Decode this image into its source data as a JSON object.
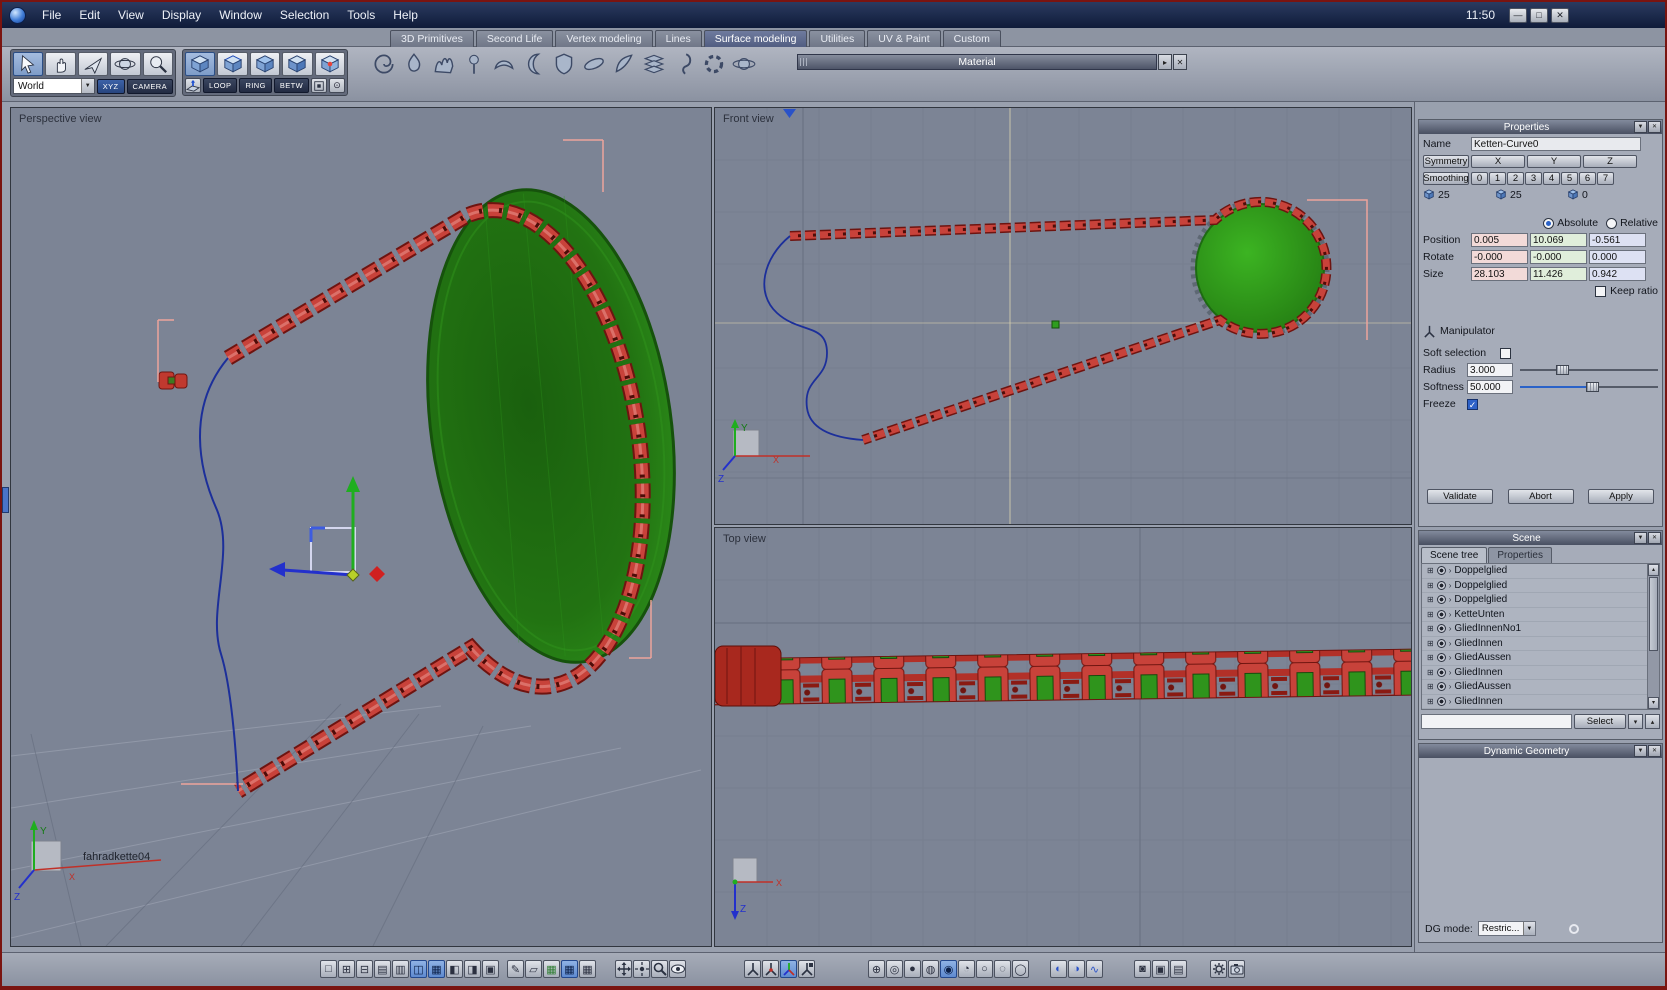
{
  "colors": {
    "accent_blue": "#3a72c8",
    "chain_red": "#c8423a",
    "sprocket_green": "#2f941c",
    "selection_blue": "#5e8ad0"
  },
  "menubar": {
    "clock": "11:50",
    "items": [
      "File",
      "Edit",
      "View",
      "Display",
      "Window",
      "Selection",
      "Tools",
      "Help"
    ]
  },
  "tabs": [
    "3D Primitives",
    "Second Life",
    "Vertex modeling",
    "Lines",
    "Surface modeling",
    "Utilities",
    "UV & Paint",
    "Custom"
  ],
  "toolbar": {
    "world": "World",
    "xyz": "XYZ",
    "camera": "CAMERA",
    "loop": "LOOP",
    "ring": "RING",
    "betw": "BETW",
    "material": "Material"
  },
  "viewports": {
    "perspective": {
      "label": "Perspective view",
      "object_label": "fahradkette04"
    },
    "front": {
      "label": "Front view"
    },
    "top": {
      "label": "Top view"
    },
    "axis": {
      "x": "X",
      "y": "Y",
      "z": "Z"
    }
  },
  "properties": {
    "title": "Properties",
    "name_label": "Name",
    "name_value": "Ketten-Curve0",
    "symmetry": "Symmetry",
    "axes": [
      "X",
      "Y",
      "Z"
    ],
    "smoothing": "Smoothing",
    "levels": [
      "0",
      "1",
      "2",
      "3",
      "4",
      "5",
      "6",
      "7"
    ],
    "counts": [
      "25",
      "25",
      "0"
    ],
    "absolute": "Absolute",
    "relative": "Relative",
    "position_label": "Position",
    "rotate_label": "Rotate",
    "size_label": "Size",
    "position": [
      "0.005",
      "10.069",
      "-0.561"
    ],
    "rotate": [
      "-0.000",
      "-0.000",
      "0.000"
    ],
    "size": [
      "28.103",
      "11.426",
      "0.942"
    ],
    "keep_ratio": "Keep ratio",
    "manipulator": "Manipulator",
    "soft_selection": "Soft selection",
    "radius_label": "Radius",
    "radius_value": "3.000",
    "softness_label": "Softness",
    "softness_value": "50.000",
    "freeze": "Freeze",
    "validate": "Validate",
    "abort": "Abort",
    "apply": "Apply"
  },
  "scene": {
    "title": "Scene",
    "tab_tree": "Scene tree",
    "tab_properties": "Properties",
    "items": [
      "Doppelglied",
      "Doppelglied",
      "Doppelglied",
      "KetteUnten",
      "GliedInnenNo1",
      "GliedInnen",
      "GliedAussen",
      "GliedInnen",
      "GliedAussen",
      "GliedInnen"
    ],
    "filter_value": "",
    "select": "Select"
  },
  "dynamic_geometry": {
    "title": "Dynamic Geometry",
    "dg_mode_label": "DG mode:",
    "dg_mode_value": "Restric..."
  },
  "icons": {
    "close": "✕",
    "collapse": "▼",
    "dropdown": "▼",
    "dropdown_small": "▾",
    "up_small": "▴",
    "right_arrow": "▸",
    "minimize": "—",
    "maximize": "□",
    "tree_expand": "⊞",
    "tree_arrow": "›",
    "target": "⊙",
    "bottombar_layouts": [
      "□",
      "⊞",
      "⊟",
      "▤",
      "▥",
      "◫",
      "▦",
      "◧",
      "◨",
      "▣"
    ],
    "bottombar_display": [
      "✎",
      "▱",
      "▦",
      "▦",
      "▦"
    ],
    "bottombar_spheres": [
      "⊕",
      "◎",
      "●",
      "◍",
      "◉",
      "◔",
      "○",
      "◌",
      "◯"
    ],
    "bottombar_curves": [
      "◐",
      "◑",
      "∿"
    ],
    "bottombar_solids": [
      "◙",
      "▣",
      "▤"
    ]
  }
}
